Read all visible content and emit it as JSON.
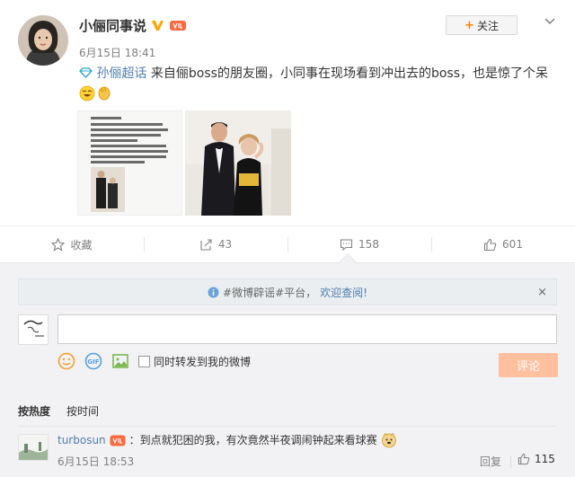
{
  "post": {
    "author": "小俪同事说",
    "date": "6月15日 18:41",
    "follow_label": "关注",
    "topic": "孙俪超话",
    "text": " 来自俪boss的朋友圈，小同事在现场看到冲出去的boss，也是惊了个呆",
    "photo1_text": "追星成功😊\n我跑上前去，我说了先生你好我是孙俪，我特别喜欢看你打球，我可以和你拍个照片吗？\n然后我心怦怦怦的在跳，因为我怕他会拒绝我😊然后你们看看我的脸，笑的和傻子一样……哈哈哈哈哈",
    "actions": {
      "favorite": "收藏",
      "repost": "43",
      "comment": "158",
      "like": "601"
    }
  },
  "comments_panel": {
    "notice_prefix": "#微博辟谣#平台，",
    "notice_link": "欢迎查阅!",
    "notice_close": "×",
    "input_placeholder": "",
    "repost_label": "同时转发到我的微博",
    "submit_label": "评论",
    "sort_hot": "按热度",
    "sort_time": "按时间",
    "comment": {
      "user": "turbosun",
      "text": "：到点就犯困的我，有次竟然半夜调闹钟起来看球赛",
      "time": "6月15日 18:53",
      "reply_label": "回复",
      "likes": "115"
    }
  },
  "colors": {
    "link": "#507daf",
    "accent": "#ff8200",
    "submit_disabled": "#ffc09f",
    "verified": "#ffa500"
  }
}
